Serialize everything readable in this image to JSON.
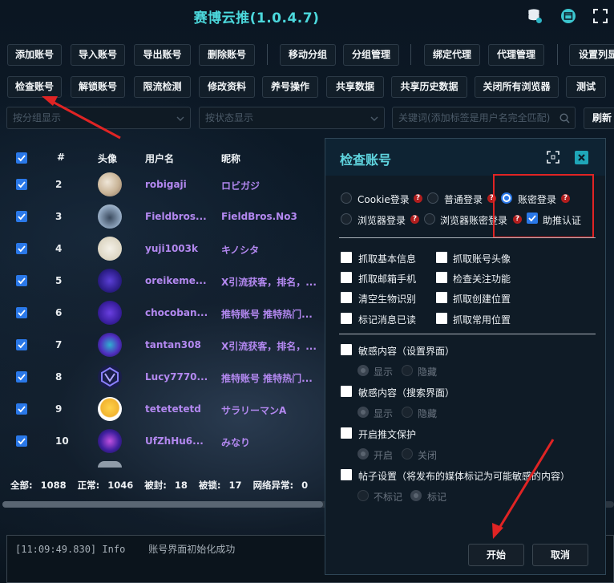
{
  "app": {
    "title": "赛博云推(1.0.4.7)"
  },
  "titlebar_icons": [
    "database-icon",
    "window-icon",
    "expand-icon"
  ],
  "toolbar_row1": [
    "添加账号",
    "导入账号",
    "导出账号",
    "删除账号",
    "移动分组",
    "分组管理",
    "绑定代理",
    "代理管理",
    "设置列显"
  ],
  "toolbar_row2": [
    "检查账号",
    "解锁账号",
    "限流检测",
    "修改资料",
    "养号操作",
    "共享数据",
    "共享历史数据",
    "关闭所有浏览器",
    "测试"
  ],
  "filters": {
    "group_placeholder": "按分组显示",
    "status_placeholder": "按状态显示",
    "keyword_placeholder": "关键词(添加标签是用户名完全匹配)",
    "refresh_label": "刷新"
  },
  "table": {
    "headers": [
      "#",
      "头像",
      "用户名",
      "昵称"
    ],
    "rows": [
      {
        "num": "2",
        "username": "robigaji",
        "nickname": "ロビガジ"
      },
      {
        "num": "3",
        "username": "Fieldbros...",
        "nickname": "FieldBros.No3"
      },
      {
        "num": "4",
        "username": "yuji1003k",
        "nickname": "キノシタ"
      },
      {
        "num": "5",
        "username": "oreikeme...",
        "nickname": "X引流获客，排名，..."
      },
      {
        "num": "6",
        "username": "chocoban...",
        "nickname": "推特账号 推特热门..."
      },
      {
        "num": "7",
        "username": "tantan308",
        "nickname": "X引流获客，排名，..."
      },
      {
        "num": "8",
        "username": "Lucy7770...",
        "nickname": "推特账号 推特热门..."
      },
      {
        "num": "9",
        "username": "tetetetetd",
        "nickname": "サラリーマンA"
      },
      {
        "num": "10",
        "username": "UfZhHu6...",
        "nickname": "みなり"
      }
    ]
  },
  "stats": {
    "total_label": "全部:",
    "total": "1088",
    "normal_label": "正常:",
    "normal": "1046",
    "banned_label": "被封:",
    "banned": "18",
    "locked_label": "被锁:",
    "locked": "17",
    "neterr_label": "网络异常:",
    "neterr": "0"
  },
  "log": {
    "timestamp": "[11:09:49.830]",
    "level": "Info",
    "message": "账号界面初始化成功"
  },
  "dialog": {
    "title": "检查账号",
    "login_options": [
      {
        "label": "Cookie登录",
        "selected": false,
        "help": true
      },
      {
        "label": "普通登录",
        "selected": false,
        "help": true
      },
      {
        "label": "账密登录",
        "selected": true,
        "help": true
      },
      {
        "label": "浏览器登录",
        "selected": false,
        "help": true
      },
      {
        "label": "浏览器账密登录",
        "selected": false,
        "help": true
      }
    ],
    "assist_auth": {
      "label": "助推认证",
      "checked": true
    },
    "fetch_options": [
      "抓取基本信息",
      "抓取账号头像",
      "抓取邮箱手机",
      "检查关注功能",
      "清空生物识别",
      "抓取创建位置",
      "标记消息已读",
      "抓取常用位置"
    ],
    "sensitive_settings": {
      "label": "敏感内容（设置界面）",
      "opt_show": "显示",
      "opt_hide": "隐藏"
    },
    "sensitive_search": {
      "label": "敏感内容（搜索界面）",
      "opt_show": "显示",
      "opt_hide": "隐藏"
    },
    "tweet_protect": {
      "label": "开启推文保护",
      "opt_on": "开启",
      "opt_off": "关闭"
    },
    "post_settings": {
      "label": "帖子设置（将发布的媒体标记为可能敏感的内容）",
      "opt_no_mark": "不标记",
      "opt_mark": "标记"
    },
    "start_label": "开始",
    "cancel_label": "取消",
    "help_mark": "?"
  },
  "colors": {
    "accent": "#2a78e8",
    "title": "#4cd8dc",
    "username": "#b388f0",
    "annotation": "#e02424"
  }
}
